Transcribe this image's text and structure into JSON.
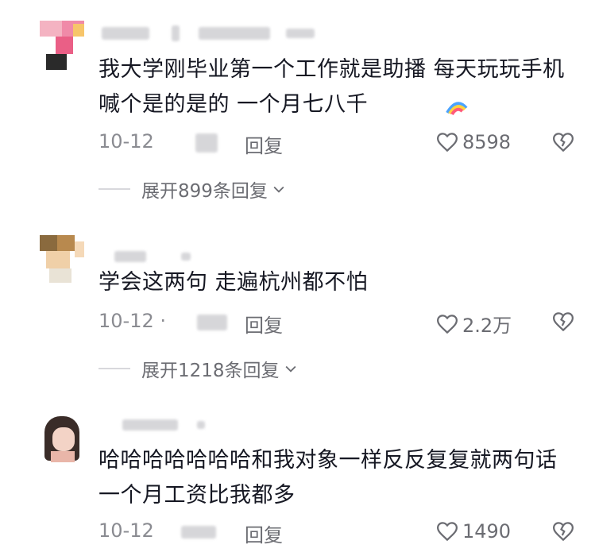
{
  "comments": [
    {
      "text": "我大学刚毕业第一个工作就是助播 每天玩玩手机喊个是的是的 一个月七八千",
      "date": "10-12",
      "reply_label": "回复",
      "likes": "8598",
      "expand_label": "展开899条回复"
    },
    {
      "text": "学会这两句 走遍杭州都不怕",
      "date": "10-12 ·",
      "reply_label": "回复",
      "likes": "2.2万",
      "expand_label": "展开1218条回复"
    },
    {
      "text": "哈哈哈哈哈哈哈和我对象一样反反复复就两句话一个月工资比我都多",
      "date": "10-12",
      "reply_label": "回复",
      "likes": "1490"
    }
  ],
  "icons": {
    "like": "heart-outline-icon",
    "dislike": "broken-heart-icon",
    "expand": "chevron-down-icon",
    "emoji": "rainbow-emoji-icon"
  },
  "colors": {
    "text": "#161823",
    "meta": "#8a8b91"
  }
}
